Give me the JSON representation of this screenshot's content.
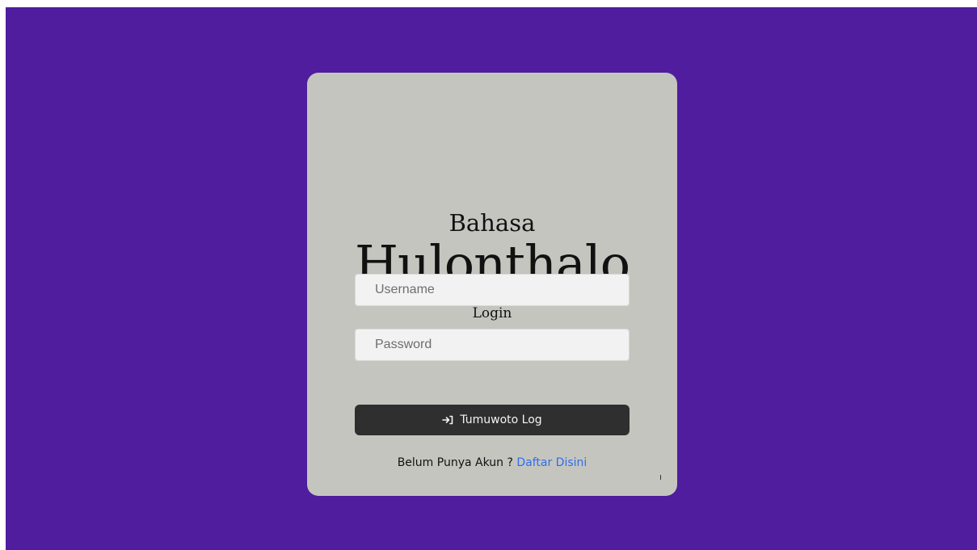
{
  "app": {
    "title_small": "Bahasa",
    "title_big": "Hulonthalo",
    "subtitle": "Login"
  },
  "form": {
    "username_placeholder": "Username",
    "username_value": "",
    "password_placeholder": "Password",
    "password_value": "",
    "submit_label": "Tumuwoto Log",
    "submit_icon": "login-arrow-icon"
  },
  "footer": {
    "prompt": "Belum Punya Akun ?",
    "register_link": "Daftar Disini"
  },
  "colors": {
    "background": "#4f1d9e",
    "card": "#c5c5c0",
    "button": "#2f2f2f",
    "link": "#2f6fe8"
  }
}
